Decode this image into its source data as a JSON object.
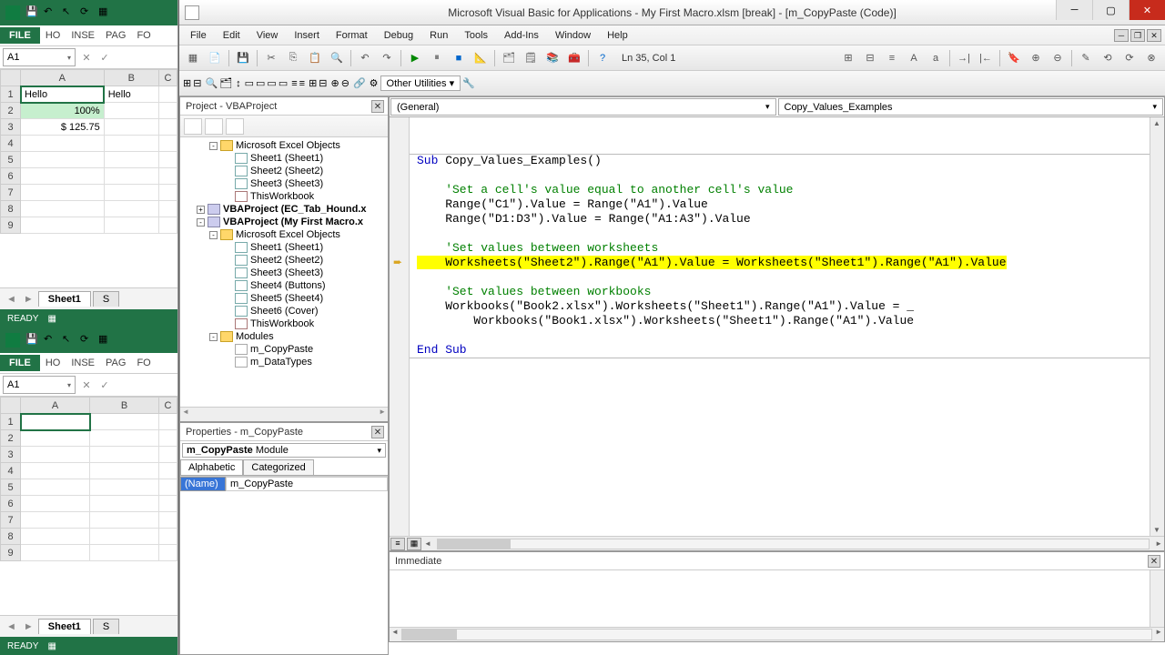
{
  "excel1": {
    "file_tab": "FILE",
    "tabs": [
      "HO",
      "INSE",
      "PAG",
      "FO"
    ],
    "namebox": "A1",
    "col_headers": [
      "A",
      "B",
      "C"
    ],
    "row_headers": [
      "1",
      "2",
      "3",
      "4",
      "5",
      "6",
      "7",
      "8",
      "9"
    ],
    "cells": {
      "A1": "Hello",
      "A2": "100%",
      "A3": "$ 125.75",
      "B1": "Hello"
    },
    "sheet_tab": "Sheet1",
    "sheet_tab_next": "S",
    "status": "READY"
  },
  "excel2": {
    "file_tab": "FILE",
    "tabs": [
      "HO",
      "INSE",
      "PAG",
      "FO"
    ],
    "namebox": "A1",
    "col_headers": [
      "A",
      "B",
      "C"
    ],
    "row_headers": [
      "1",
      "2",
      "3",
      "4",
      "5",
      "6",
      "7",
      "8",
      "9"
    ],
    "sheet_tab": "Sheet1",
    "sheet_tab_next": "S",
    "status": "READY"
  },
  "vbe": {
    "title": "Microsoft Visual Basic for Applications - My First Macro.xlsm [break] - [m_CopyPaste (Code)]",
    "menus": [
      "File",
      "Edit",
      "View",
      "Insert",
      "Format",
      "Debug",
      "Run",
      "Tools",
      "Add-Ins",
      "Window",
      "Help"
    ],
    "cursor_pos": "Ln 35, Col 1",
    "other_util": "Other Utilities",
    "project": {
      "title": "Project - VBAProject",
      "tree": [
        {
          "level": 2,
          "exp": "-",
          "icon": "folder",
          "label": "Microsoft Excel Objects"
        },
        {
          "level": 3,
          "icon": "sheet",
          "label": "Sheet1 (Sheet1)"
        },
        {
          "level": 3,
          "icon": "sheet",
          "label": "Sheet2 (Sheet2)"
        },
        {
          "level": 3,
          "icon": "sheet",
          "label": "Sheet3 (Sheet3)"
        },
        {
          "level": 3,
          "icon": "wb",
          "label": "ThisWorkbook"
        },
        {
          "level": 1,
          "exp": "+",
          "icon": "proj",
          "label": "VBAProject (EC_Tab_Hound.x",
          "bold": true
        },
        {
          "level": 1,
          "exp": "-",
          "icon": "proj",
          "label": "VBAProject (My First Macro.x",
          "bold": true
        },
        {
          "level": 2,
          "exp": "-",
          "icon": "folder",
          "label": "Microsoft Excel Objects"
        },
        {
          "level": 3,
          "icon": "sheet",
          "label": "Sheet1 (Sheet1)"
        },
        {
          "level": 3,
          "icon": "sheet",
          "label": "Sheet2 (Sheet2)"
        },
        {
          "level": 3,
          "icon": "sheet",
          "label": "Sheet3 (Sheet3)"
        },
        {
          "level": 3,
          "icon": "sheet",
          "label": "Sheet4 (Buttons)"
        },
        {
          "level": 3,
          "icon": "sheet",
          "label": "Sheet5 (Sheet4)"
        },
        {
          "level": 3,
          "icon": "sheet",
          "label": "Sheet6 (Cover)"
        },
        {
          "level": 3,
          "icon": "wb",
          "label": "ThisWorkbook"
        },
        {
          "level": 2,
          "exp": "-",
          "icon": "folder",
          "label": "Modules"
        },
        {
          "level": 3,
          "icon": "mod",
          "label": "m_CopyPaste"
        },
        {
          "level": 3,
          "icon": "mod",
          "label": "m_DataTypes"
        }
      ]
    },
    "properties": {
      "title": "Properties - m_CopyPaste",
      "object": "m_CopyPaste",
      "object_type": "Module",
      "tab_alpha": "Alphabetic",
      "tab_cat": "Categorized",
      "rows": [
        {
          "key": "(Name)",
          "val": "m_CopyPaste"
        }
      ]
    },
    "code": {
      "obj_dd": "(General)",
      "proc_dd": "Copy_Values_Examples",
      "lines": [
        {
          "t": "",
          "cls": ""
        },
        {
          "t": "",
          "cls": ""
        },
        {
          "t": "Sub Copy_Values_Examples()",
          "cls": "kw-sub"
        },
        {
          "t": "",
          "cls": ""
        },
        {
          "t": "    'Set a cell's value equal to another cell's value",
          "cls": "comment"
        },
        {
          "t": "    Range(\"C1\").Value = Range(\"A1\").Value",
          "cls": ""
        },
        {
          "t": "    Range(\"D1:D3\").Value = Range(\"A1:A3\").Value",
          "cls": ""
        },
        {
          "t": "",
          "cls": ""
        },
        {
          "t": "    'Set values between worksheets",
          "cls": "comment"
        },
        {
          "t": "    Worksheets(\"Sheet2\").Range(\"A1\").Value = Worksheets(\"Sheet1\").Range(\"A1\").Value",
          "cls": "hl",
          "arrow": true
        },
        {
          "t": "",
          "cls": ""
        },
        {
          "t": "    'Set values between workbooks",
          "cls": "comment"
        },
        {
          "t": "    Workbooks(\"Book2.xlsx\").Worksheets(\"Sheet1\").Range(\"A1\").Value = _",
          "cls": ""
        },
        {
          "t": "        Workbooks(\"Book1.xlsx\").Worksheets(\"Sheet1\").Range(\"A1\").Value",
          "cls": ""
        },
        {
          "t": "",
          "cls": ""
        },
        {
          "t": "End Sub",
          "cls": "kw"
        }
      ]
    },
    "immediate": {
      "title": "Immediate"
    }
  }
}
